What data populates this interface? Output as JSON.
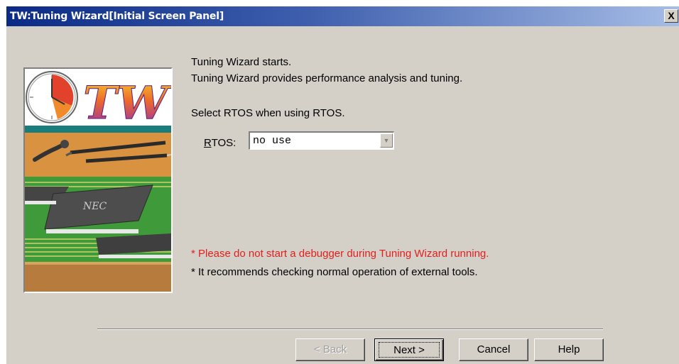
{
  "window": {
    "title": "TW:Tuning Wizard[Initial Screen Panel]",
    "close_label": "X"
  },
  "content": {
    "line1": "Tuning Wizard starts.",
    "line2": "Tuning Wizard provides performance analysis and tuning.",
    "line3": "Select RTOS when using RTOS.",
    "rtos_label_mnemonic": "R",
    "rtos_label_rest": "TOS:",
    "rtos_value": "no use",
    "warning": "* Please do not start a debugger during Tuning Wizard running.",
    "note": "* It recommends checking normal operation of external tools."
  },
  "banner": {
    "logo_text": "TW",
    "chip_text": "NEC"
  },
  "buttons": {
    "back": "< Back",
    "next": "Next >",
    "cancel": "Cancel",
    "help": "Help"
  },
  "colors": {
    "title_gradient_start": "#0b2a86",
    "title_gradient_end": "#a6bde6",
    "warning": "#e0201e",
    "dialog_face": "#d4d0c8"
  }
}
